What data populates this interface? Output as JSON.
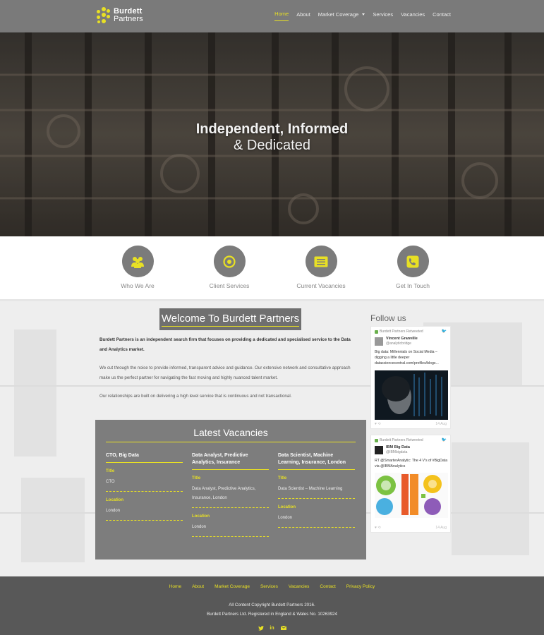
{
  "brand": {
    "line1": "Burdett",
    "line2": "Partners"
  },
  "nav": [
    {
      "label": "Home",
      "active": true
    },
    {
      "label": "About"
    },
    {
      "label": "Market Coverage",
      "dropdown": true
    },
    {
      "label": "Services"
    },
    {
      "label": "Vacancies"
    },
    {
      "label": "Contact"
    }
  ],
  "hero": {
    "line1": "Independent, Informed",
    "line2": "& Dedicated"
  },
  "features": [
    {
      "label": "Who We Are",
      "icon": "users-icon"
    },
    {
      "label": "Client Services",
      "icon": "target-icon"
    },
    {
      "label": "Current Vacancies",
      "icon": "list-icon"
    },
    {
      "label": "Get In Touch",
      "icon": "phone-icon"
    }
  ],
  "welcome": {
    "title": "Welcome To Burdett Partners",
    "p1": "Burdett Partners is an independent search firm that focuses on providing a dedicated and specialised service to the Data and Analytics market.",
    "p2": "We cut through the noise to provide informed, transparent advice and guidance. Our extensive network and consultative approach make us the perfect partner for navigating the fast moving and highly nuanced talent market.",
    "p3": "Our relationships are built on delivering a high level service that is continuous and not transactional."
  },
  "vacancies": {
    "title": "Latest Vacancies",
    "title_key": "Title",
    "location_key": "Location",
    "items": [
      {
        "heading": "CTO, Big Data",
        "title": "CTO",
        "location": "London"
      },
      {
        "heading": "Data Analyst, Predictive Analytics, Insurance",
        "title": "Data Analyst, Predictive Analytics, Insurance, London",
        "location": "London"
      },
      {
        "heading": "Data Scientist, Machine Learning, Insurance, London",
        "title": "Data Scientist – Machine Learning",
        "location": "London"
      }
    ]
  },
  "twitter": {
    "heading": "Follow us",
    "retweet_label": "Burdett Partners Retweeted",
    "tweets": [
      {
        "name": "Vincent Granville",
        "handle": "@analyticbridge",
        "text": "Big data: Millennials on Social Media – digging a little deeper datasciencecentral.com/profiles/blogs...",
        "date": "14 Aug"
      },
      {
        "name": "IBM Big Data",
        "handle": "@IBMbigdata",
        "text": "RT @SmarterAnalytic: The 4 V's of #BigData via @IBMAnalytics",
        "date": "14 Aug"
      }
    ]
  },
  "footer": {
    "links": [
      "Home",
      "About",
      "Market Coverage",
      "Services",
      "Vacancies",
      "Contact",
      "Privacy Policy"
    ],
    "copyright": "All Content Copyright Burdett Partners 2016.",
    "registered": "Burdett Partners Ltd. Registered in England & Wales No. 10263924"
  },
  "colors": {
    "accent": "#e8e024",
    "header": "#7a7a7a",
    "footer": "#585858"
  }
}
